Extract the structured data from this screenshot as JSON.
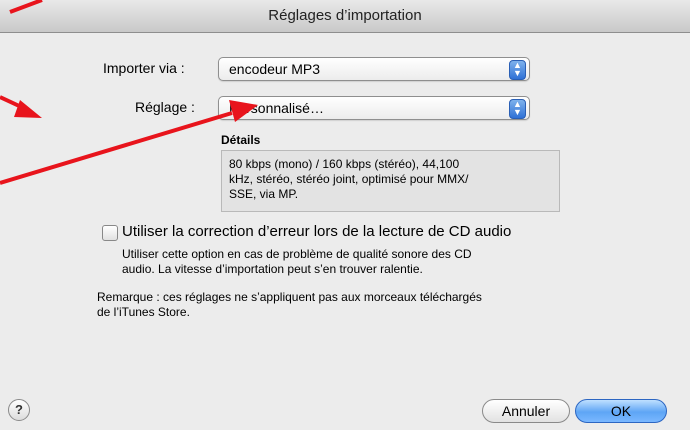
{
  "window": {
    "title": "Réglages d’importation"
  },
  "form": {
    "import_via_label": "Importer via :",
    "import_via_value": "encodeur MP3",
    "setting_label": "Réglage :",
    "setting_value": "Personnalisé…",
    "details_label": "Détails",
    "details_lines": [
      "80 kbps (mono) / 160 kbps (stéréo), 44,100",
      "kHz, stéréo, stéréo joint, optimisé pour MMX/",
      "SSE, via MP."
    ]
  },
  "error_correction": {
    "checkbox_label": "Utiliser la correction d’erreur lors de la lecture de CD audio",
    "checked": false,
    "help_lines": [
      "Utiliser cette option en cas de problème de qualité sonore des CD",
      "audio. La vitesse d’importation peut s’en trouver ralentie."
    ]
  },
  "remark_lines": [
    "Remarque : ces réglages ne s’appliquent pas aux morceaux téléchargés",
    "de l’iTunes Store."
  ],
  "buttons": {
    "help": "?",
    "cancel": "Annuler",
    "ok": "OK"
  },
  "colors": {
    "annotation_arrow": "#e8141c",
    "default_button": "#5ea5f5"
  }
}
